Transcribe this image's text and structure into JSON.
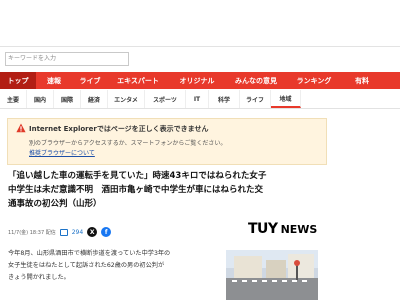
{
  "search": {
    "placeholder": "キーワードを入力"
  },
  "nav": {
    "items": [
      "トップ",
      "速報",
      "ライブ",
      "エキスパート",
      "オリジナル",
      "みんなの意見",
      "ランキング",
      "有料"
    ]
  },
  "subnav": {
    "items": [
      "主要",
      "国内",
      "国際",
      "経済",
      "エンタメ",
      "スポーツ",
      "IT",
      "科学",
      "ライフ",
      "地域"
    ]
  },
  "notice": {
    "title": "Internet Explorerではページを正しく表示できません",
    "text": "別のブラウザーからアクセスするか、スマートフォンからご覧ください。",
    "link": "推奨ブラウザーについて"
  },
  "article": {
    "headline_lines": [
      "「追い越した車の運転手を見ていた」時速43キロではねられた女子",
      "中学生は未だ意識不明　酒田市亀ヶ崎で中学生が車にはねられた交",
      "通事故の初公判（山形）"
    ],
    "date": "11/7(金) 18:37 配信",
    "comment_count": "294",
    "body_lines": [
      "今年8月、山形県酒田市で横断歩道を渡っていた中学3年の",
      "女子生徒をはねたとして起訴された62歳の男の初公判が",
      "きょう開かれました。"
    ]
  },
  "logo": {
    "brand": "TUY",
    "suffix": "NEWS"
  },
  "colors": {
    "nav_bg": "#e8392b",
    "nav_active": "#b21e14",
    "notice_bg": "#fff4df",
    "link": "#1b4ea8"
  }
}
